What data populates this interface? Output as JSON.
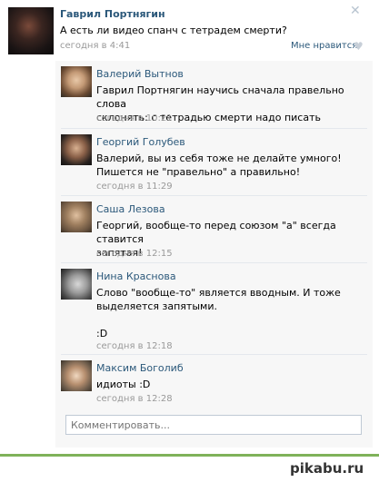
{
  "post": {
    "author": "Гаврил Портнягин",
    "text": "А есть ли видео спанч с тетрадем смерти?",
    "time": "сегодня в 4:41",
    "like_label": "Мне нравится",
    "close_icon": "close-icon",
    "heart_icon": "heart-icon"
  },
  "comments": [
    {
      "name": "Валерий Вытнов",
      "text": "Гаврил Портнягин научись сначала правельно слова\nсклонять: с тетрадью смерти надо писать",
      "time": "сегодня в 10:21"
    },
    {
      "name": "Георгий Голубев",
      "text": "Валерий, вы из себя тоже не делайте умного!\nПишется не \"правельно\" а правильно!",
      "time": "сегодня в 11:29"
    },
    {
      "name": "Саша Лезова",
      "text": "Георгий, вообще-то перед союзом \"а\" всегда ставится\nзапятая!",
      "time": "сегодня в 12:15"
    },
    {
      "name": "Нина Краснова",
      "text": "Слово \"вообще-то\" является вводным. И тоже\nвыделяется запятыми.\n\n:D",
      "time": "сегодня в 12:18"
    },
    {
      "name": "Максим Боголиб",
      "text": "идиоты :D",
      "time": "сегодня в 12:28"
    }
  ],
  "comment_input": {
    "placeholder": "Комментировать..."
  },
  "footer": {
    "logo": "pikabu.ru",
    "accent_color": "#7fb25a"
  },
  "colors": {
    "link": "#2b587a",
    "muted": "#999999",
    "comment_bg": "#f7f7f7"
  }
}
